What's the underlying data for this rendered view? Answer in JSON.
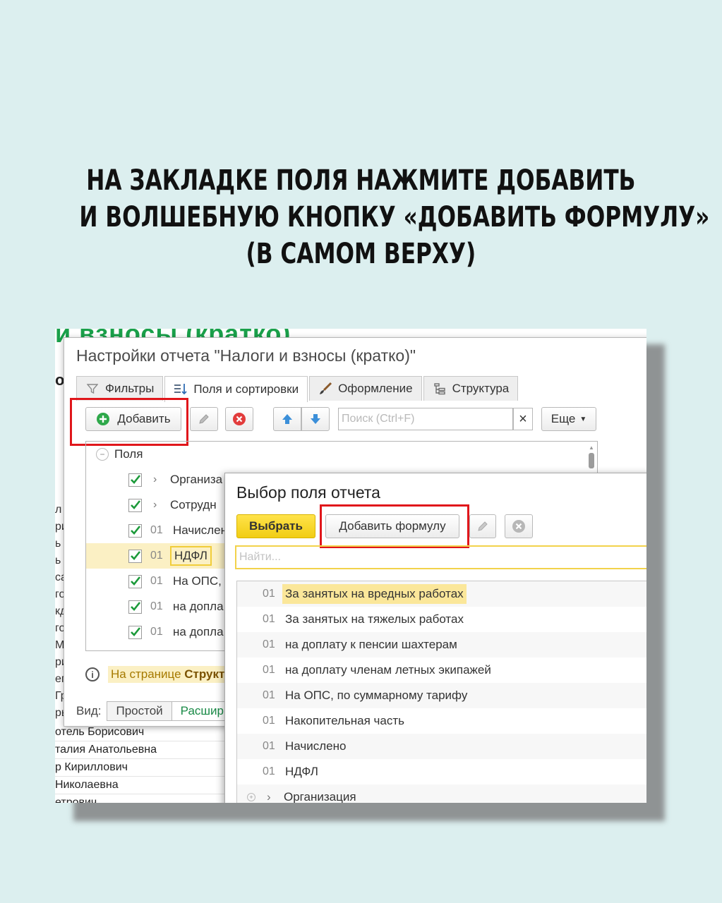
{
  "headline": {
    "line1": "НА ЗАКЛАДКЕ ПОЛЯ НАЖМИТЕ ДОБАВИТЬ",
    "line2": "И ВОЛШЕБНУЮ КНОПКУ «ДОБАВИТЬ ФОРМУЛУ»",
    "line3": "(В САМОМ ВЕРХУ)"
  },
  "background": {
    "title_fragment": "и взносы (кратко)",
    "o_fragment": "о",
    "row_letters": [
      "л",
      "ри",
      "ь I",
      "ь I",
      "са",
      "го",
      "кд",
      "го",
      "М",
      "ри",
      "ег",
      "Гр",
      "рь"
    ],
    "names": [
      "отель Борисович",
      "талия Анатольевна",
      "р Кириллович",
      " Николаевна",
      "етрович"
    ]
  },
  "settings_dialog": {
    "title": "Настройки отчета \"Налоги и взносы (кратко)\"",
    "tabs": [
      {
        "label": "Фильтры",
        "icon": "filter-icon"
      },
      {
        "label": "Поля и сортировки",
        "icon": "sort-icon"
      },
      {
        "label": "Оформление",
        "icon": "brush-icon"
      },
      {
        "label": "Структура",
        "icon": "structure-icon"
      }
    ],
    "add_label": "Добавить",
    "search_placeholder": "Поиск (Ctrl+F)",
    "search_clear": "×",
    "more_label": "Еще",
    "tree_root": "Поля",
    "tree_rows": [
      {
        "code": "",
        "label": "Организа",
        "expand": true
      },
      {
        "code": "",
        "label": "Сотрудн",
        "expand": true
      },
      {
        "code": "01",
        "label": "Начислен",
        "expand": false
      },
      {
        "code": "01",
        "label": "НДФЛ",
        "expand": false,
        "selected": true
      },
      {
        "code": "01",
        "label": "На ОПС,",
        "expand": false
      },
      {
        "code": "01",
        "label": "на допла",
        "expand": false
      },
      {
        "code": "01",
        "label": "на допла",
        "expand": false
      }
    ],
    "info_prefix": "На странице",
    "info_bold": "Структ",
    "view_label": "Вид:",
    "view_simple": "Простой",
    "view_extended": "Расшир"
  },
  "field_dialog": {
    "title": "Выбор поля отчета",
    "select_label": "Выбрать",
    "add_formula_label": "Добавить формулу",
    "find_placeholder": "Найти...",
    "items": [
      {
        "code": "01",
        "label": "За занятых на вредных работах",
        "highlight": true
      },
      {
        "code": "01",
        "label": "За занятых на тяжелых работах"
      },
      {
        "code": "01",
        "label": "на доплату к пенсии шахтерам"
      },
      {
        "code": "01",
        "label": "на доплату членам летных экипажей"
      },
      {
        "code": "01",
        "label": "На ОПС, по суммарному тарифу"
      },
      {
        "code": "01",
        "label": "Накопительная часть"
      },
      {
        "code": "01",
        "label": "Начислено"
      },
      {
        "code": "01",
        "label": "НДФЛ"
      },
      {
        "code": "",
        "label": "Организация",
        "group": true
      }
    ]
  },
  "colors": {
    "highlight_frame": "#e0161b",
    "select_button": "#f5d51d",
    "check_green": "#1c9a3a",
    "page_background": "#dcefef"
  }
}
